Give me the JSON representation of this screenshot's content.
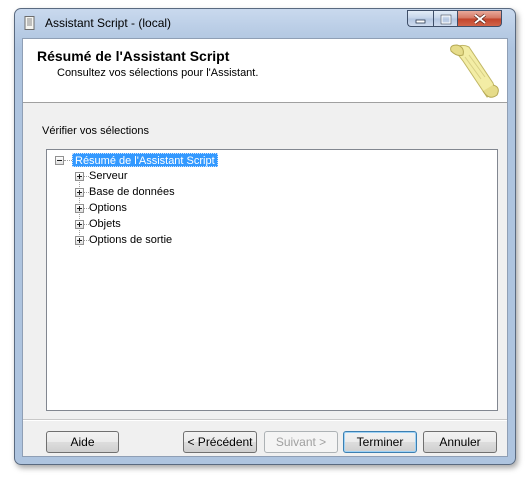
{
  "window": {
    "title": "Assistant Script - (local)"
  },
  "header": {
    "title": "Résumé de l'Assistant Script",
    "subtitle": "Consultez vos sélections pour l'Assistant."
  },
  "main": {
    "verify_label": "Vérifier vos sélections",
    "tree": {
      "root": {
        "label": "Résumé de l'Assistant Script",
        "expanded": true,
        "selected": true
      },
      "children": [
        {
          "label": "Serveur",
          "expanded": false
        },
        {
          "label": "Base de données",
          "expanded": false
        },
        {
          "label": "Options",
          "expanded": false
        },
        {
          "label": "Objets",
          "expanded": false
        },
        {
          "label": "Options de sortie",
          "expanded": false
        }
      ]
    }
  },
  "buttons": {
    "help": "Aide",
    "previous": "< Précédent",
    "next": "Suivant >",
    "finish": "Terminer",
    "cancel": "Annuler"
  },
  "colors": {
    "selection": "#3399ff",
    "window_frame": "#aec4df",
    "close_button": "#c2432b"
  },
  "icons": [
    "app-script-icon",
    "minimize-icon",
    "maximize-icon",
    "close-icon",
    "scroll-icon",
    "expand-icon",
    "collapse-icon"
  ]
}
